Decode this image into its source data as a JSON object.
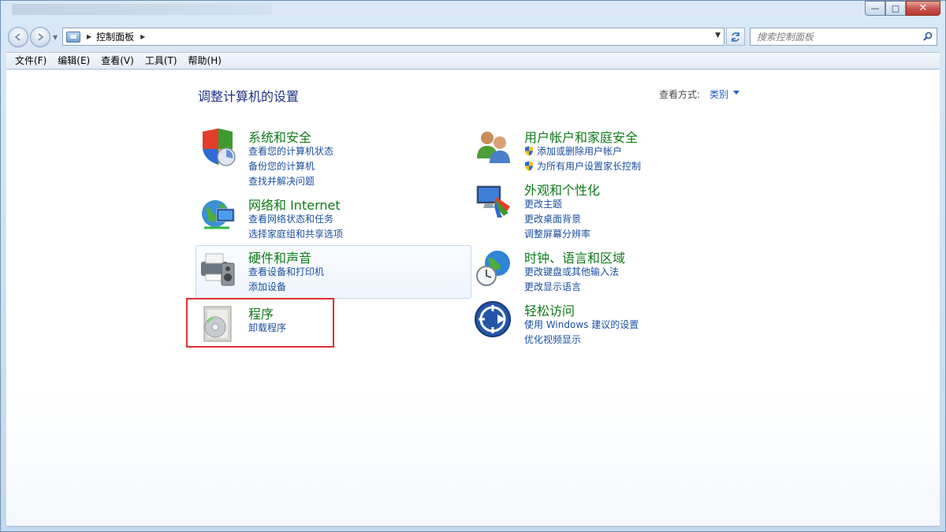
{
  "window": {
    "controls": {
      "minimize": "—",
      "maximize": "□",
      "close": "✕"
    }
  },
  "address": {
    "crumb": "控制面板",
    "search_placeholder": "搜索控制面板"
  },
  "menu": [
    "文件(F)",
    "编辑(E)",
    "查看(V)",
    "工具(T)",
    "帮助(H)"
  ],
  "content": {
    "title": "调整计算机的设置",
    "view_by_label": "查看方式:",
    "view_by_value": "类别",
    "categories_left": [
      {
        "title": "系统和安全",
        "icon": "shield-security-icon",
        "links": [
          "查看您的计算机状态",
          "备份您的计算机",
          "查找并解决问题"
        ]
      },
      {
        "title": "网络和 Internet",
        "icon": "network-globe-icon",
        "links": [
          "查看网络状态和任务",
          "选择家庭组和共享选项"
        ]
      },
      {
        "title": "硬件和声音",
        "icon": "printer-speaker-icon",
        "links": [
          "查看设备和打印机",
          "添加设备"
        ]
      },
      {
        "title": "程序",
        "icon": "programs-disc-icon",
        "links": [
          "卸载程序"
        ]
      }
    ],
    "categories_right": [
      {
        "title": "用户帐户和家庭安全",
        "icon": "users-icon",
        "links": [
          "添加或删除用户帐户",
          "为所有用户设置家长控制"
        ]
      },
      {
        "title": "外观和个性化",
        "icon": "monitor-palette-icon",
        "links": [
          "更改主题",
          "更改桌面背景",
          "调整屏幕分辨率"
        ]
      },
      {
        "title": "时钟、语言和区域",
        "icon": "clock-globe-icon",
        "links": [
          "更改键盘或其他输入法",
          "更改显示语言"
        ]
      },
      {
        "title": "轻松访问",
        "icon": "ease-of-access-icon",
        "links": [
          "使用 Windows 建议的设置",
          "优化视频显示"
        ]
      }
    ]
  }
}
